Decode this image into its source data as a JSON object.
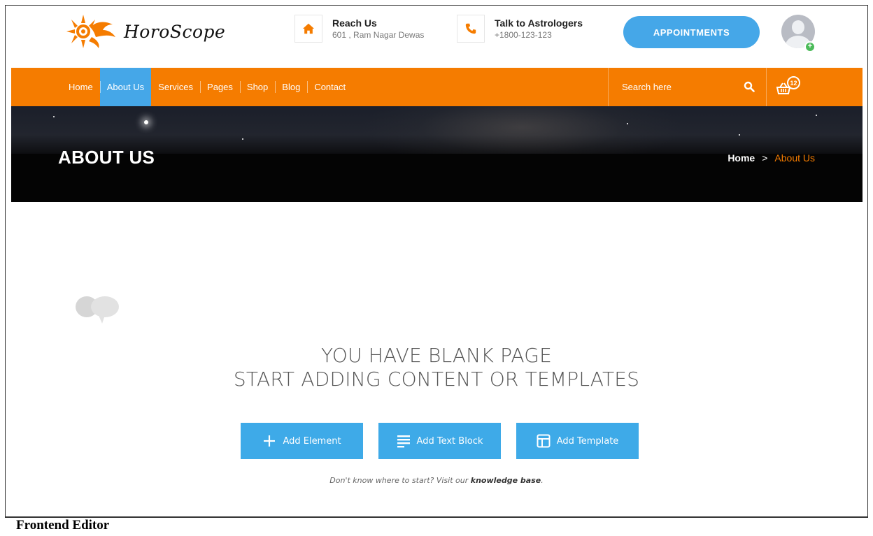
{
  "brand": {
    "name": "HoroScope"
  },
  "contact": {
    "reach": {
      "title": "Reach Us",
      "subtitle": "601 , Ram Nagar Dewas",
      "icon": "home-icon"
    },
    "talk": {
      "title": "Talk to Astrologers",
      "subtitle": "+1800-123-123",
      "icon": "phone-icon"
    }
  },
  "header": {
    "appointments_label": "APPOINTMENTS",
    "avatar_badge": "+"
  },
  "nav": {
    "items": [
      {
        "label": "Home"
      },
      {
        "label": "About Us",
        "active": true
      },
      {
        "label": "Services"
      },
      {
        "label": "Pages"
      },
      {
        "label": "Shop"
      },
      {
        "label": "Blog"
      },
      {
        "label": "Contact"
      }
    ],
    "search_placeholder": "Search here",
    "cart_count": "12"
  },
  "hero": {
    "title": "ABOUT US",
    "breadcrumb": {
      "home": "Home",
      "separator": ">",
      "current": "About Us"
    }
  },
  "blank": {
    "line1": "YOU HAVE BLANK PAGE",
    "line2": "START ADDING CONTENT OR TEMPLATES",
    "buttons": {
      "add_element": "Add Element",
      "add_text_block": "Add Text Block",
      "add_template": "Add Template"
    },
    "help_prefix": "Don't know where to start? Visit our ",
    "help_link": "knowledge base",
    "help_suffix": "."
  },
  "caption": "Frontend Editor",
  "colors": {
    "accent_orange": "#f57c00",
    "accent_blue": "#45a7e8",
    "button_blue": "#3eaae8"
  }
}
